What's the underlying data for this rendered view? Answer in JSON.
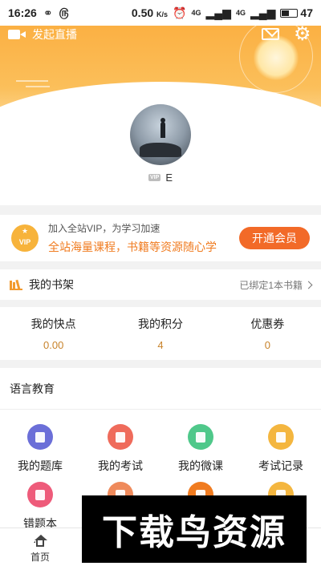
{
  "status_bar": {
    "time": "16:26",
    "speed": "0.50",
    "speed_unit": "K/s",
    "network1": "4G",
    "network2": "4G",
    "battery": "47"
  },
  "header": {
    "live_label": "发起直播"
  },
  "profile": {
    "vip_tag": "VIP",
    "username": "E"
  },
  "vip_card": {
    "badge": "VIP",
    "line1": "加入全站VIP，为学习加速",
    "line2": "全站海量课程，书籍等资源随心学",
    "button": "开通会员"
  },
  "bookshelf": {
    "title": "我的书架",
    "status": "已绑定1本书籍"
  },
  "stats": [
    {
      "label": "我的快点",
      "value": "0.00"
    },
    {
      "label": "我的积分",
      "value": "4"
    },
    {
      "label": "优惠券",
      "value": "0"
    }
  ],
  "language_section": {
    "title": "语言教育",
    "items": [
      {
        "label": "我的题库",
        "color": "#6b6fd8",
        "icon": "question-bank-icon"
      },
      {
        "label": "我的考试",
        "color": "#ef6b5b",
        "icon": "exam-icon"
      },
      {
        "label": "我的微课",
        "color": "#4fc88a",
        "icon": "micro-course-icon"
      },
      {
        "label": "考试记录",
        "color": "#f4b63f",
        "icon": "exam-record-icon"
      },
      {
        "label": "错题本",
        "color": "#ee5b7a",
        "icon": "wrong-answers-icon"
      },
      {
        "label": "",
        "color": "#ef8a5b",
        "icon": "item-icon"
      },
      {
        "label": "",
        "color": "#f07b1f",
        "icon": "item-icon"
      },
      {
        "label": "",
        "color": "#f4b63f",
        "icon": "item-icon"
      }
    ]
  },
  "bottom_nav": [
    {
      "label": "首页",
      "active": false
    },
    {
      "label": "",
      "active": false
    },
    {
      "label": "",
      "active": false
    },
    {
      "label": "",
      "active": true
    }
  ],
  "watermark": "下载鸟资源"
}
